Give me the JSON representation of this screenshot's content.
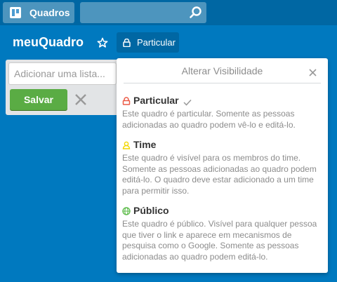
{
  "topbar": {
    "boards_label": "Quadros",
    "search_placeholder": ""
  },
  "board": {
    "title": "meuQuadro",
    "visibility_label": "Particular"
  },
  "composer": {
    "placeholder": "Adicionar uma lista...",
    "save_label": "Salvar"
  },
  "popover": {
    "title": "Alterar Visibilidade",
    "options": [
      {
        "name": "Particular",
        "selected": true,
        "icon": "lock-icon",
        "color": "#eb5a46",
        "description": "Este quadro é particular. Somente as pessoas adicionadas ao quadro podem vê-lo e editá-lo."
      },
      {
        "name": "Time",
        "selected": false,
        "icon": "team-icon",
        "color": "#f2d600",
        "description": "Este quadro é visível para os membros do time. Somente as pessoas adicionadas ao quadro podem editá-lo. O quadro deve estar adicionado a um time para permitir isso."
      },
      {
        "name": "Público",
        "selected": false,
        "icon": "globe-icon",
        "color": "#61bd4f",
        "description": "Este quadro é público. Visível para qualquer pessoa que tiver o link e aparece em mecanismos de pesquisa como o Google. Somente as pessoas adicionadas ao quadro podem editá-lo."
      }
    ]
  },
  "colors": {
    "background": "#0079bf",
    "header": "#0067a3",
    "save_button": "#5aac44"
  }
}
